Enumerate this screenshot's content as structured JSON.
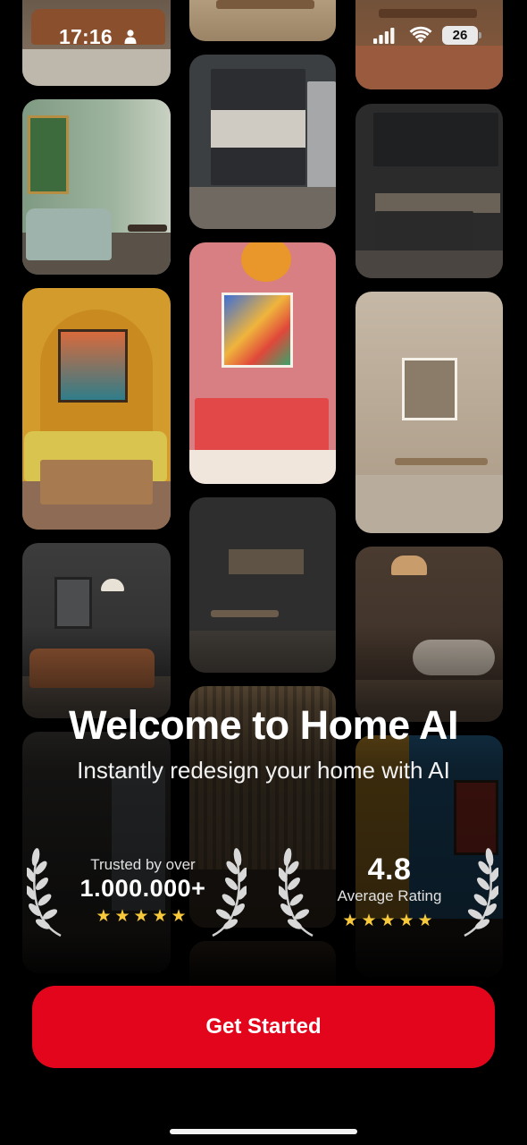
{
  "status_bar": {
    "time": "17:16",
    "battery_level": "26",
    "icons": [
      "person-icon",
      "signal-icon",
      "wifi-icon",
      "battery-icon"
    ]
  },
  "gallery": {
    "tiles": [
      {
        "label": "leather-sofa-living-room"
      },
      {
        "label": "green-eclectic-living-room"
      },
      {
        "label": "yellow-arched-living-room"
      },
      {
        "label": "dark-living-room-leather-sofa"
      },
      {
        "label": "dark-interior-window"
      },
      {
        "label": "console-table-room"
      },
      {
        "label": "dark-modern-kitchen"
      },
      {
        "label": "pink-wall-art-console"
      },
      {
        "label": "dark-kitchen-dining"
      },
      {
        "label": "wood-slat-room"
      },
      {
        "label": "brick-floor-room"
      },
      {
        "label": "black-kitchen-island"
      },
      {
        "label": "beige-wabi-sabi-room"
      },
      {
        "label": "rustic-living-room"
      },
      {
        "label": "blue-wall-shelves"
      }
    ]
  },
  "welcome": {
    "title": "Welcome to Home AI",
    "subtitle": "Instantly redesign your home with AI"
  },
  "stats": {
    "users": {
      "caption": "Trusted by over",
      "value": "1.000.000+",
      "stars": "★★★★★"
    },
    "rating": {
      "value": "4.8",
      "caption": "Average Rating",
      "stars": "★★★★★"
    }
  },
  "cta": {
    "label": "Get Started"
  },
  "colors": {
    "accent": "#e3051b",
    "star": "#f8c93b",
    "background": "#000000"
  }
}
